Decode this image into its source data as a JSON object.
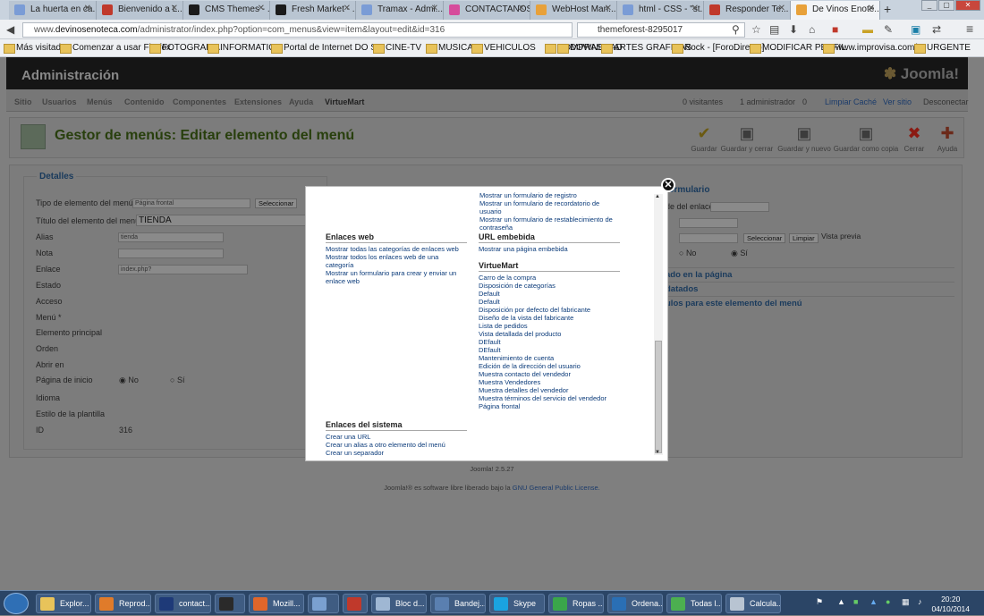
{
  "tabs": [
    {
      "label": "La huerta en ca...",
      "color": "#7a9cd6"
    },
    {
      "label": "Bienvenido a L...",
      "color": "#c0392b"
    },
    {
      "label": "CMS Themes - ...",
      "color": "#1b1b1b"
    },
    {
      "label": "Fresh Market - ...",
      "color": "#1b1b1b"
    },
    {
      "label": "Tramax - Admi...",
      "color": "#7a9cd6"
    },
    {
      "label": "CONTACTANOS",
      "color": "#d64c9c"
    },
    {
      "label": "WebHost Man...",
      "color": "#e8a13a"
    },
    {
      "label": "html - CSS - \"st...",
      "color": "#7a9cd6"
    },
    {
      "label": "Responder Te...",
      "color": "#c0392b"
    },
    {
      "label": "De Vinos Enote...",
      "color": "#e8a13a"
    }
  ],
  "url": {
    "prefix": "www.",
    "domain": "devinosenoteca.com",
    "rest": "/administrator/index.php?option=com_menus&view=item&layout=edit&id=316"
  },
  "search": {
    "value": "themeforest-8295017"
  },
  "bookmarks": [
    "Más visitados",
    "Comenzar a usar Firefox",
    "FOTOGRAFIA",
    "INFORMATICA",
    "Portal de Internet DO S...",
    "CINE-TV",
    "MUSICA",
    "VEHICULOS",
    "COMPRAS",
    "DOWNLOAD",
    "ARTES GRAFICAS",
    "Rock - [ForoDirecto]",
    "MODIFICAR PERFIL",
    "www.improvisa.com/...",
    "URGENTE"
  ],
  "admin": {
    "title": "Administración",
    "logo": "Joomla!",
    "menu": [
      "Sitio",
      "Usuarios",
      "Menús",
      "Contenido",
      "Componentes",
      "Extensiones",
      "Ayuda",
      "VirtueMart"
    ],
    "status": {
      "visitors": "0 visitantes",
      "admins": "1 administrador",
      "messages": "0",
      "cache": "Limpiar Caché",
      "site": "Ver sitio",
      "logout": "Desconectar"
    },
    "page_title": "Gestor de menús: Editar elemento del menú",
    "toolbar": [
      "Guardar",
      "Guardar y cerrar",
      "Guardar y nuevo",
      "Guardar como copia",
      "Cerrar",
      "Ayuda"
    ]
  },
  "details": {
    "legend": "Detalles",
    "labels": [
      "Tipo de elemento del menú *",
      "Título del elemento del menú *",
      "Alias",
      "Nota",
      "Enlace",
      "Estado",
      "Acceso",
      "Menú *",
      "Elemento principal",
      "Orden",
      "Abrir en",
      "Página de inicio",
      "Idioma",
      "Estilo de la plantilla",
      "ID"
    ],
    "type_value": "Página frontal",
    "select_button": "Seleccionar",
    "title_value": "TIENDA",
    "alias_value": "tienda",
    "link_value": "index.php?option=com_virtuemart&view=virtue",
    "home_no": "No",
    "home_yes": "Sí",
    "id_value": "316"
  },
  "right_panel": {
    "legend": "formulario",
    "link_label": "de del enlace",
    "select": "Seleccionar",
    "clear": "Limpiar",
    "preview": "Vista previa",
    "no": "No",
    "yes": "Sí",
    "sections": [
      "ado en la página",
      "datados",
      "ulos para este elemento del menú"
    ]
  },
  "footer": {
    "version": "Joomla! 2.5.27",
    "license_prefix": "Joomla!® es software libre liberado bajo la",
    "license_link": "GNU General Public License."
  },
  "modal": {
    "top_links": [
      "Mostrar un formulario de registro",
      "Mostrar un formulario de recordatorio de usuario",
      "Mostrar un formulario de restablecimiento de contraseña"
    ],
    "weblinks": {
      "title": "Enlaces web",
      "items": [
        "Mostrar todas las categorías de enlaces web",
        "Mostrar todos los enlaces web de una categoría",
        "Mostrar un formulario para crear y enviar un enlace web"
      ]
    },
    "wrapper": {
      "title": "URL embebida",
      "items": [
        "Mostrar una página embebida"
      ]
    },
    "virtuemart": {
      "title": "VirtueMart",
      "items": [
        "Carro de la compra",
        "Disposición de categorías",
        "Default",
        "Default",
        "Disposición por defecto del fabricante",
        "Diseño de la vista del fabricante",
        "Lista de pedidos",
        "Vista detallada del producto",
        "DEfault",
        "DEfault",
        "Mantenimiento de cuenta",
        "Edición de la dirección del usuario",
        "Muestra contacto del vendedor",
        "Muestra Vendedores",
        "Muestra detalles del vendedor",
        "Muestra términos del servicio del vendedor",
        "Página frontal"
      ]
    },
    "system": {
      "title": "Enlaces del sistema",
      "items": [
        "Crear una URL",
        "Crear un alias a otro elemento del menú",
        "Crear un separador"
      ]
    }
  },
  "taskbar": {
    "items": [
      {
        "label": "Explor...",
        "color": "#e8c35a"
      },
      {
        "label": "Reprod...",
        "color": "#e07b2a"
      },
      {
        "label": "contact...",
        "color": "#1e3a78"
      },
      {
        "label": "",
        "color": "#2a2a2a"
      },
      {
        "label": "Mozill...",
        "color": "#e0662a"
      },
      {
        "label": "",
        "color": "#7aa0d0"
      },
      {
        "label": "",
        "color": "#c0392b"
      },
      {
        "label": "Bloc d...",
        "color": "#9fb7d3"
      },
      {
        "label": "Bandej...",
        "color": "#5a7fb0"
      },
      {
        "label": "Skype",
        "color": "#1aa3e0"
      },
      {
        "label": "Ropas ...",
        "color": "#3aa64a"
      },
      {
        "label": "Ordena...",
        "color": "#2a6fb5"
      },
      {
        "label": "Todas l...",
        "color": "#4caf50"
      },
      {
        "label": "Calcula...",
        "color": "#b8c4d2"
      }
    ],
    "time": "20:20",
    "date": "04/10/2014"
  }
}
